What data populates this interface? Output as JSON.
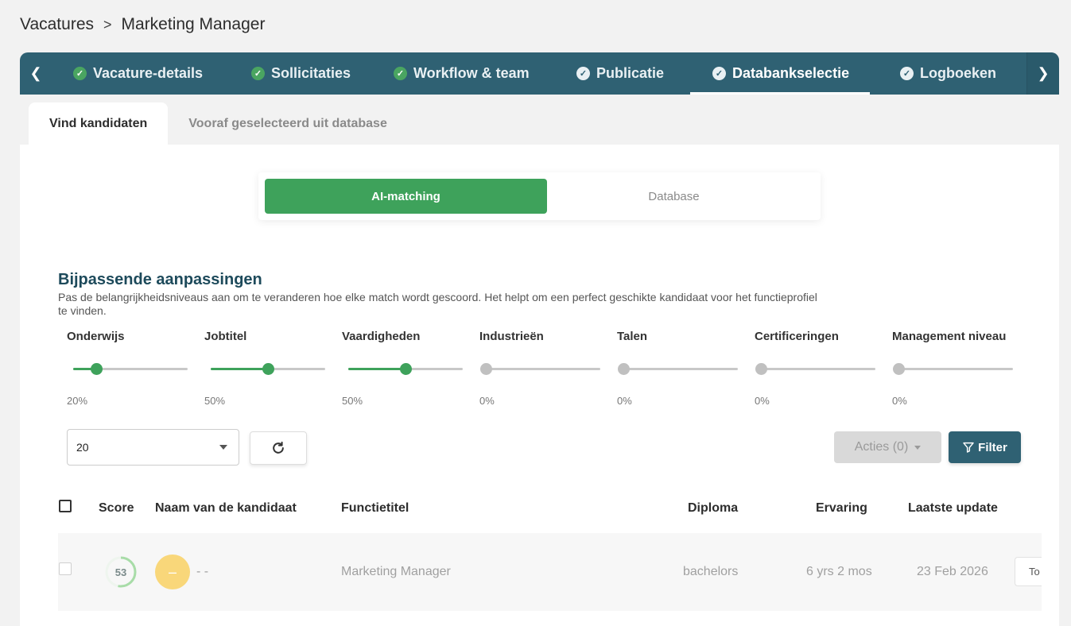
{
  "breadcrumb": {
    "parent": "Vacatures",
    "separator": ">",
    "current": "Marketing Manager"
  },
  "tabs": [
    {
      "label": "Vacature-details",
      "state": "done"
    },
    {
      "label": "Sollicitaties",
      "state": "done"
    },
    {
      "label": "Workflow & team",
      "state": "done"
    },
    {
      "label": "Publicatie",
      "state": "outline"
    },
    {
      "label": "Databankselectie",
      "state": "active"
    },
    {
      "label": "Logboeken",
      "state": "outline"
    }
  ],
  "subtabs": [
    {
      "label": "Vind kandidaten",
      "active": true
    },
    {
      "label": "Vooraf geselecteerd uit database",
      "active": false
    }
  ],
  "mode_toggle": {
    "selected": "AI-matching",
    "other": "Database"
  },
  "adjustments": {
    "title": "Bijpassende aanpassingen",
    "description": "Pas de belangrijkheidsniveaus aan om te veranderen hoe elke match wordt gescoord. Het helpt om een perfect geschikte kandidaat voor het functieprofiel te vinden.",
    "sliders": [
      {
        "label": "Onderwijs",
        "value": 20,
        "display": "20%"
      },
      {
        "label": "Jobtitel",
        "value": 50,
        "display": "50%"
      },
      {
        "label": "Vaardigheden",
        "value": 50,
        "display": "50%"
      },
      {
        "label": "Industrieën",
        "value": 0,
        "display": "0%"
      },
      {
        "label": "Talen",
        "value": 0,
        "display": "0%"
      },
      {
        "label": "Certificeringen",
        "value": 0,
        "display": "0%"
      },
      {
        "label": "Management niveau",
        "value": 0,
        "display": "0%"
      }
    ]
  },
  "toolbar": {
    "page_size": "20",
    "actions_label": "Acties (0)",
    "filter_label": "Filter"
  },
  "table": {
    "headers": {
      "score": "Score",
      "name": "Naam van de kandidaat",
      "job_title": "Functietitel",
      "diploma": "Diploma",
      "experience": "Ervaring",
      "last_update": "Laatste update"
    },
    "rows": [
      {
        "score": "53",
        "score_value": 53,
        "avatar_initial": "–",
        "name": "- -",
        "job_title": "Marketing Manager",
        "diploma": "bachelors",
        "experience": "6 yrs 2 mos",
        "last_update": "23 Feb 2026",
        "action": "To"
      }
    ]
  },
  "colors": {
    "primary": "#2f6173",
    "accent_green": "#3ea25b",
    "avatar": "#f9d77a",
    "disabled": "#d9d9d9"
  }
}
